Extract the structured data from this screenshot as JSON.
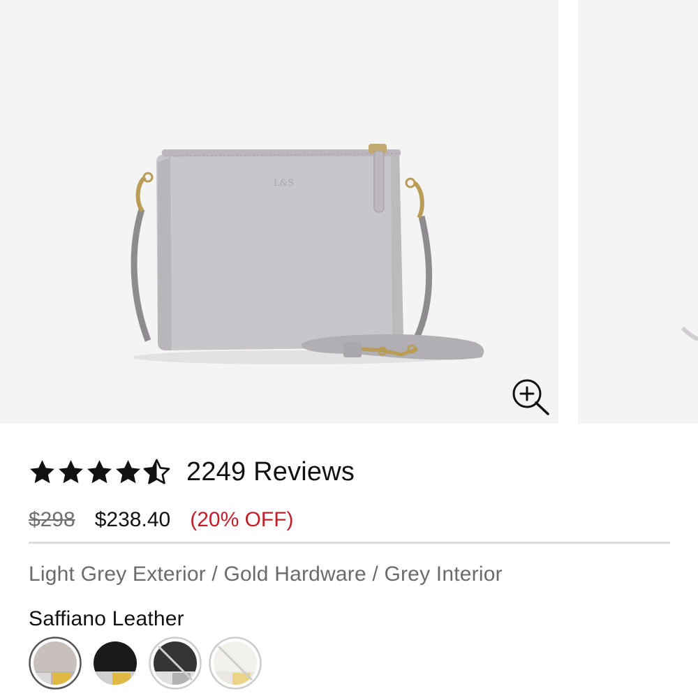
{
  "gallery": {
    "product_image": "light-grey-crossbody-bag",
    "monogram": "L&S",
    "zoom_icon": "zoom-in-icon"
  },
  "rating": {
    "value": 4.5,
    "max": 5,
    "reviews_label": "2249 Reviews"
  },
  "price": {
    "original": "$298",
    "sale": "$238.40",
    "discount": "(20% OFF)",
    "discount_color": "#c41e2a"
  },
  "color_name": "Light Grey Exterior / Gold Hardware / Grey Interior",
  "material": {
    "label": "Saffiano Leather",
    "swatches": [
      {
        "name": "light-grey-gold",
        "selected": true,
        "available": true
      },
      {
        "name": "black-gold",
        "selected": false,
        "available": true
      },
      {
        "name": "black-silver",
        "selected": false,
        "available": false
      },
      {
        "name": "white-gold",
        "selected": false,
        "available": false
      }
    ]
  }
}
